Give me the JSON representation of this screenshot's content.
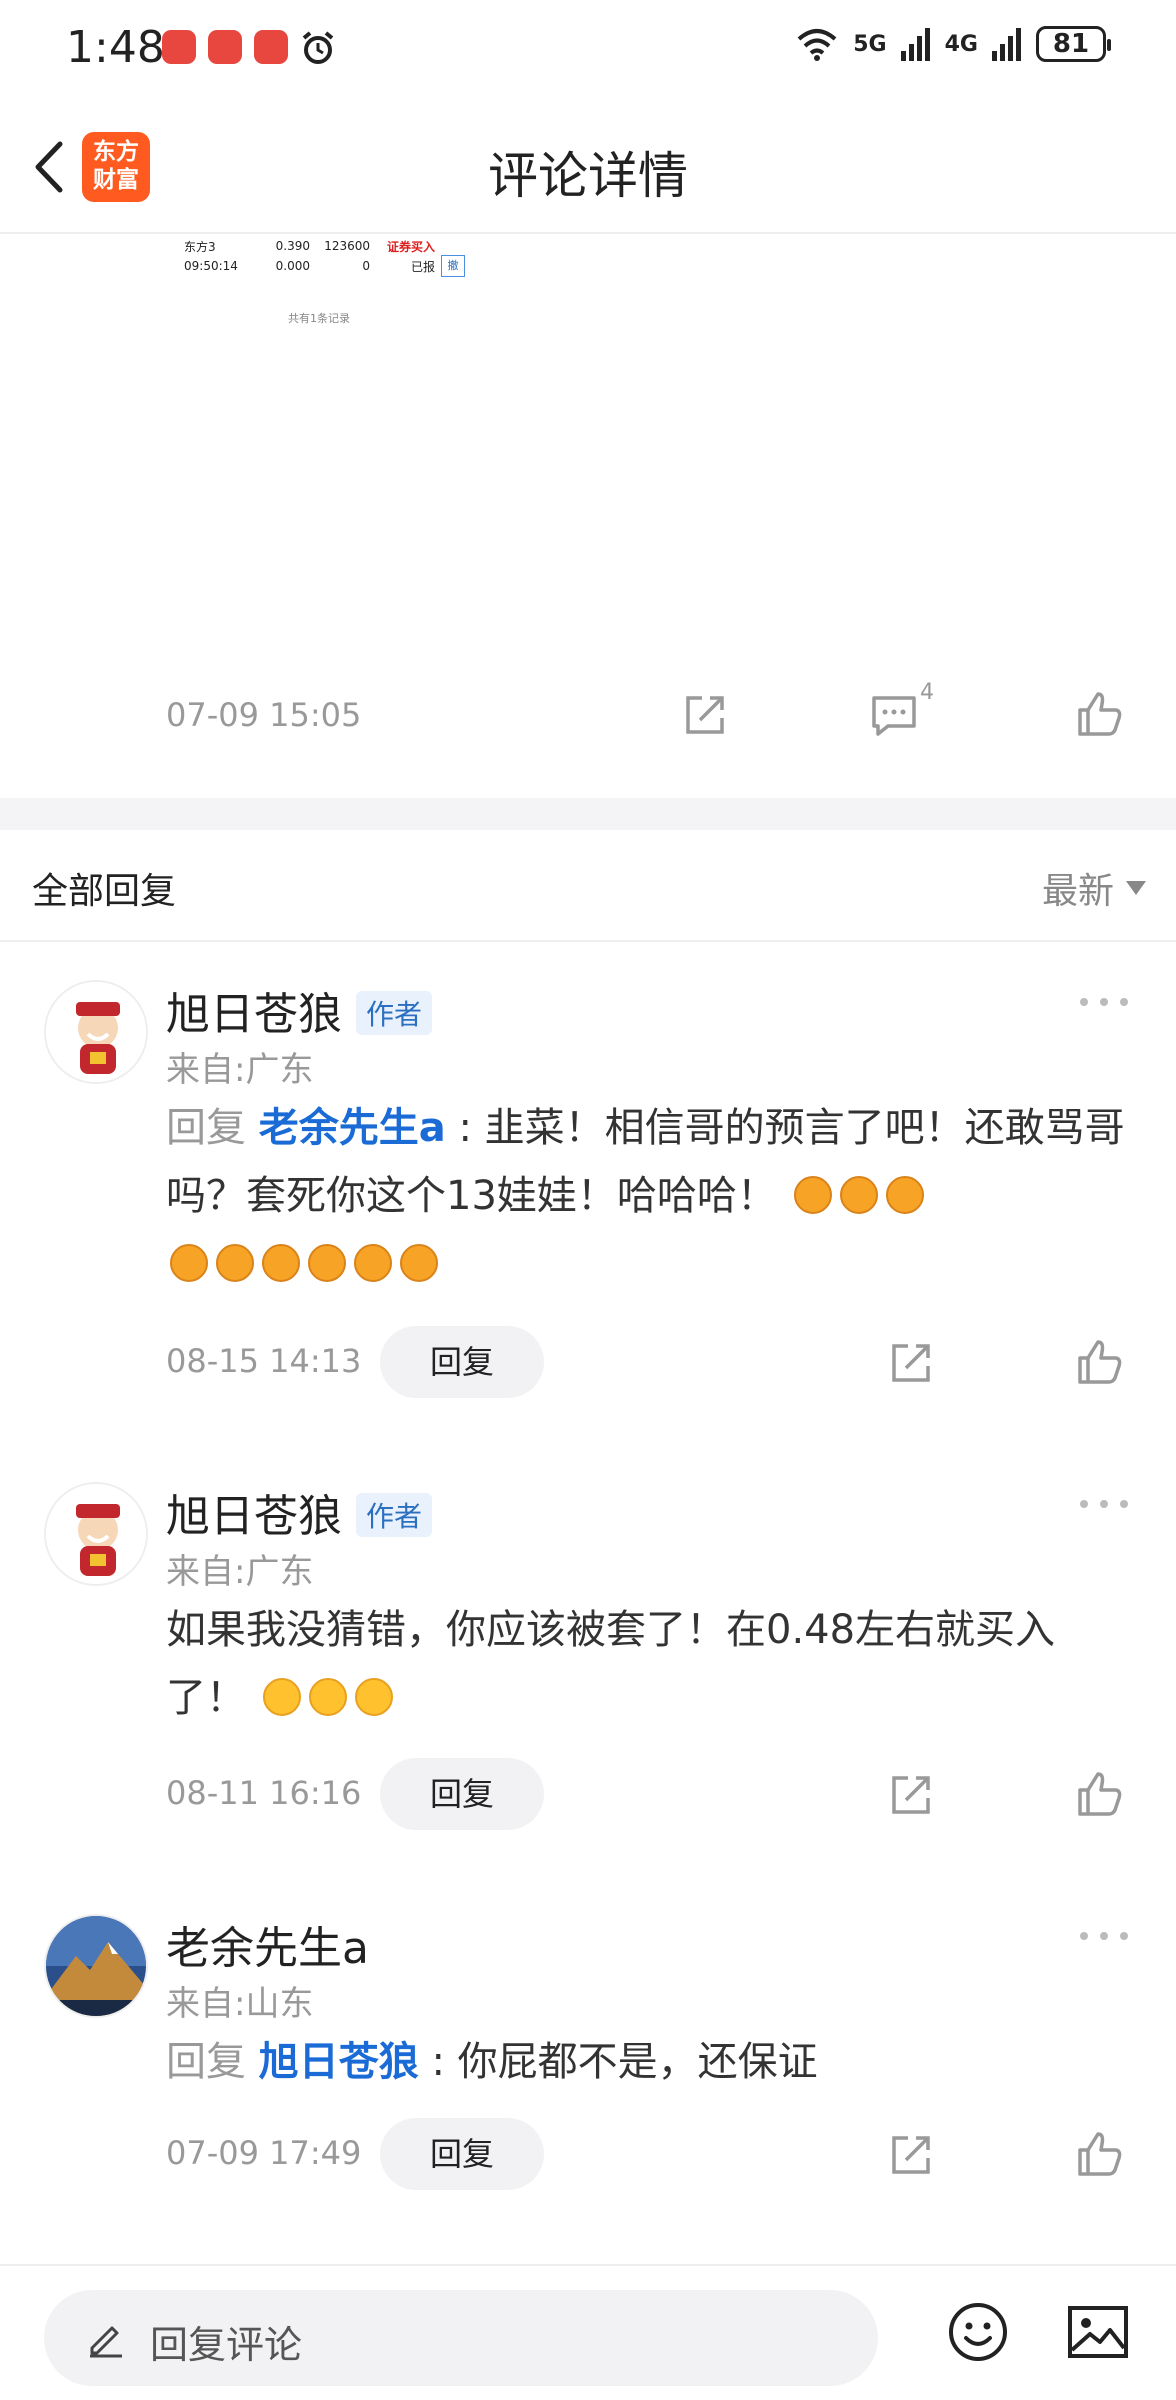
{
  "status_bar": {
    "time": "1:48",
    "network_5g": "5G",
    "network_4g": "4G",
    "battery": "81"
  },
  "header": {
    "logo_line1": "东方",
    "logo_line2": "财富",
    "title": "评论详情"
  },
  "post": {
    "image": {
      "row1": [
        "东方3",
        "0.390",
        "123600",
        "证券买入"
      ],
      "row2": [
        "09:50:14",
        "0.000",
        "0",
        "已报"
      ],
      "cancel_label": "撤",
      "note": "共有1条记录"
    },
    "time": "07-09 15:05",
    "comment_count": "4"
  },
  "replies": {
    "title": "全部回复",
    "sort_label": "最新"
  },
  "comments": [
    {
      "name": "旭日苍狼",
      "badge": "作者",
      "location": "来自:广东",
      "reply_label": "回复",
      "reply_target": "老余先生a",
      "text": ": 韭菜！相信哥的预言了吧！还敢骂哥吗？套死你这个13娃娃！哈哈哈！",
      "time": "08-15 14:13",
      "reply_button": "回复"
    },
    {
      "name": "旭日苍狼",
      "badge": "作者",
      "location": "来自:广东",
      "text": "如果我没猜错，你应该被套了！在0.48左右就买入了！",
      "time": "08-11 16:16",
      "reply_button": "回复"
    },
    {
      "name": "老余先生a",
      "location": "来自:山东",
      "reply_label": "回复",
      "reply_target": "旭日苍狼",
      "text": ": 你屁都不是，还保证",
      "time": "07-09 17:49",
      "reply_button": "回复"
    }
  ],
  "bottom_bar": {
    "placeholder": "回复评论"
  },
  "colors": {
    "brand": "#ff5a1f",
    "link": "#1a6bd6",
    "muted": "#999999"
  }
}
